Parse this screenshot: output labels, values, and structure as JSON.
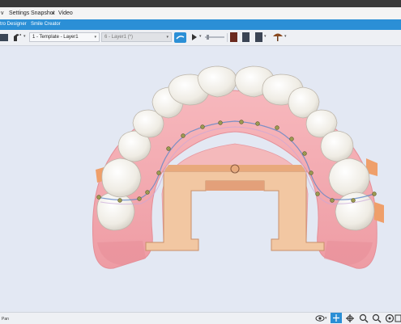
{
  "menu": {
    "items": [
      "v",
      "Settings",
      "Snapshot",
      "Video"
    ],
    "snapshot_arrow": "▾"
  },
  "tabs": [
    "tro Designer",
    "Smile Creator"
  ],
  "toolbar": {
    "template_select": "1 - Template - Layer1",
    "layer_select": "6 - Layer1 (*)",
    "play_arrow": "▾",
    "umbrella_arrow": "▾"
  },
  "status": {
    "mode": "Pan"
  },
  "colors": {
    "accent": "#2b8fd6",
    "gum": "#f2a8ad",
    "tooth": "#f7f4ee",
    "base": "#f0c59c",
    "wire": "#5e86c8",
    "bracket": "#8a8a4a"
  },
  "icons": [
    "folder-icon",
    "brush-icon",
    "flag-icon",
    "play-icon",
    "book-icon",
    "layers-icon",
    "umbrella-icon",
    "eye-icon",
    "pan-icon",
    "rotate-icon",
    "zoom-in-icon",
    "zoom-out-icon",
    "target-icon",
    "reset-view-icon"
  ]
}
